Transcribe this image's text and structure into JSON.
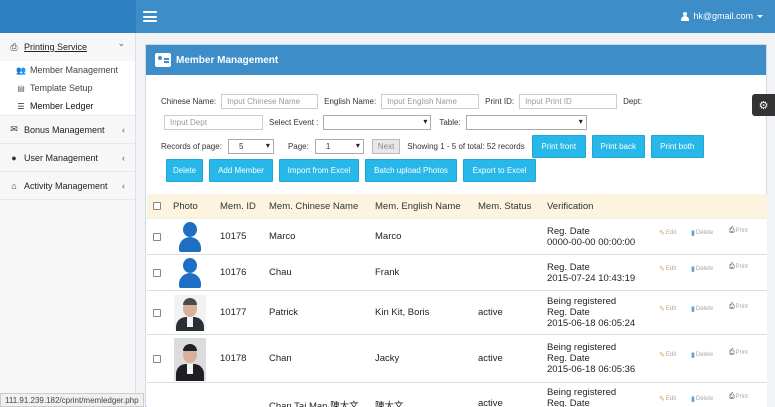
{
  "topbar": {
    "user_email": "hk@gmail.com"
  },
  "sidebar": {
    "sections": [
      {
        "label": "Printing Service",
        "arrow": "⌄"
      },
      {
        "label": "Bonus Management",
        "arrow": "‹"
      },
      {
        "label": "User Management",
        "arrow": "‹"
      },
      {
        "label": "Activity Management",
        "arrow": "‹"
      }
    ],
    "sub_items": [
      "Member Management",
      "Template Setup",
      "Member Ledger"
    ]
  },
  "status_url": "111.91.239.182/cprint/memledger.php",
  "panel": {
    "title": "Member Management",
    "filters": {
      "chinese_name_label": "Chinese Name:",
      "chinese_name_placeholder": "Input Chinese Name",
      "english_name_label": "English Name:",
      "english_name_placeholder": "Input English Name",
      "print_id_label": "Print ID:",
      "print_id_placeholder": "Input Print ID",
      "dept_label": "Dept:",
      "dept_placeholder": "Input Dept",
      "select_event_label": "Select Event :",
      "table_label": "Table:"
    },
    "records_label": "Records of page:",
    "records_value": "5",
    "page_label": "Page:",
    "page_value": "1",
    "next_label": "Next",
    "showing_text": "Showing 1 - 5 of total: 52 records",
    "buttons_row1": [
      "Print front",
      "Print back",
      "Print both"
    ],
    "buttons_row2": [
      "Delete",
      "Add Member",
      "Import from Excel",
      "Batch upload Photos",
      "Export to Excel"
    ]
  },
  "table": {
    "headers": [
      "Photo",
      "Mem. ID",
      "Mem. Chinese Name",
      "Mem. English Name",
      "Mem. Status",
      "Verification"
    ],
    "action_labels": {
      "edit": "Edit",
      "delete": "Delete",
      "print": "Print"
    },
    "rows": [
      {
        "id": "10175",
        "chinese": "Marco",
        "english": "Marco",
        "status": "",
        "verif": [
          "Reg. Date",
          "0000-00-00 00:00:00"
        ]
      },
      {
        "id": "10176",
        "chinese": "Chau",
        "english": "Frank",
        "status": "",
        "verif": [
          "Reg. Date",
          "2015-07-24 10:43:19"
        ]
      },
      {
        "id": "10177",
        "chinese": "Patrick",
        "english": "Kin Kit, Boris",
        "status": "active",
        "verif": [
          "Being registered",
          "Reg. Date",
          "2015-06-18 06:05:24"
        ]
      },
      {
        "id": "10178",
        "chinese": "Chan",
        "english": "Jacky",
        "status": "active",
        "verif": [
          "Being registered",
          "Reg. Date",
          "2015-06-18 06:05:36"
        ]
      },
      {
        "id": "",
        "chinese": "Chan Tai Man 陳大文",
        "english": "陳大文",
        "status": "active",
        "verif": [
          "Being registered",
          "Reg. Date"
        ]
      }
    ]
  },
  "colors": {
    "topbar": "#3c8dc8",
    "button": "#27b7e8",
    "header_row": "#fdf4e0"
  }
}
